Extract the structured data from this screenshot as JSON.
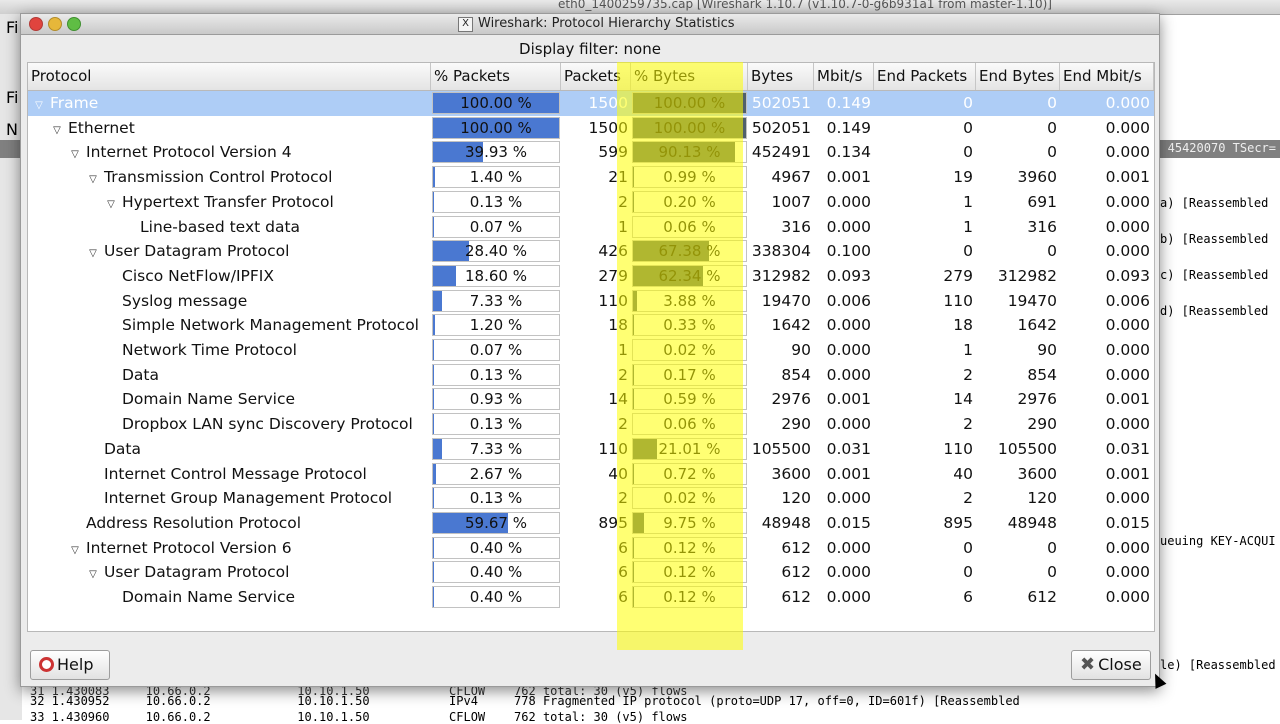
{
  "bg": {
    "title": "eth0_1400259735.cap   [Wireshark 1.10.7  (v1.10.7-0-g6b931a1 from master-1.10)]",
    "left_letters": [
      "Fi",
      "N",
      "Fi",
      "N"
    ],
    "strip_text": "45420070 TSecr=",
    "right_lines": [
      "a) [Reassembled",
      "b) [Reassembled",
      "c) [Reassembled",
      "d) [Reassembled",
      "ueuing KEY-ACQUI",
      "le) [Reassembled",
      "[Reassembled"
    ],
    "bottom_lines": [
      "31 1.430083     10.66.0.2            10.10.1.50           CFLOW    762 total: 30 (v5) flows",
      "32 1.430952     10.66.0.2            10.10.1.50           IPv4     778 Fragmented IP protocol (proto=UDP 17, off=0, ID=601f) [Reassembled",
      "33 1.430960     10.66.0.2            10.10.1.50           CFLOW    762 total: 30 (v5) flows"
    ]
  },
  "dialog": {
    "title": "Wireshark: Protocol Hierarchy Statistics",
    "filter": "Display filter: none",
    "help_label": "Help",
    "close_label": "Close"
  },
  "columns": [
    "Protocol",
    "% Packets",
    "Packets",
    "% Bytes",
    "Bytes",
    "Mbit/s",
    "End Packets",
    "End Bytes",
    "End Mbit/s"
  ],
  "rows": [
    {
      "name": "Frame",
      "indent": 0,
      "expand": true,
      "pct_packets": "100.00 %",
      "pct_packets_val": 100,
      "packets": "1500",
      "pct_bytes": "100.00 %",
      "pct_bytes_val": 100,
      "bytes": "502051",
      "mbit": "0.149",
      "end_packets": "0",
      "end_bytes": "0",
      "end_mbit": "0.000"
    },
    {
      "name": "Ethernet",
      "indent": 1,
      "expand": true,
      "pct_packets": "100.00 %",
      "pct_packets_val": 100,
      "packets": "1500",
      "pct_bytes": "100.00 %",
      "pct_bytes_val": 100,
      "bytes": "502051",
      "mbit": "0.149",
      "end_packets": "0",
      "end_bytes": "0",
      "end_mbit": "0.000"
    },
    {
      "name": "Internet Protocol Version 4",
      "indent": 2,
      "expand": true,
      "pct_packets": "39.93 %",
      "pct_packets_val": 39.93,
      "packets": "599",
      "pct_bytes": "90.13 %",
      "pct_bytes_val": 90.13,
      "bytes": "452491",
      "mbit": "0.134",
      "end_packets": "0",
      "end_bytes": "0",
      "end_mbit": "0.000"
    },
    {
      "name": "Transmission Control Protocol",
      "indent": 3,
      "expand": true,
      "pct_packets": "1.40 %",
      "pct_packets_val": 1.4,
      "packets": "21",
      "pct_bytes": "0.99 %",
      "pct_bytes_val": 0.99,
      "bytes": "4967",
      "mbit": "0.001",
      "end_packets": "19",
      "end_bytes": "3960",
      "end_mbit": "0.001"
    },
    {
      "name": "Hypertext Transfer Protocol",
      "indent": 4,
      "expand": true,
      "pct_packets": "0.13 %",
      "pct_packets_val": 0.13,
      "packets": "2",
      "pct_bytes": "0.20 %",
      "pct_bytes_val": 0.2,
      "bytes": "1007",
      "mbit": "0.000",
      "end_packets": "1",
      "end_bytes": "691",
      "end_mbit": "0.000"
    },
    {
      "name": "Line-based text data",
      "indent": 5,
      "expand": false,
      "pct_packets": "0.07 %",
      "pct_packets_val": 0.07,
      "packets": "1",
      "pct_bytes": "0.06 %",
      "pct_bytes_val": 0.06,
      "bytes": "316",
      "mbit": "0.000",
      "end_packets": "1",
      "end_bytes": "316",
      "end_mbit": "0.000"
    },
    {
      "name": "User Datagram Protocol",
      "indent": 3,
      "expand": true,
      "pct_packets": "28.40 %",
      "pct_packets_val": 28.4,
      "packets": "426",
      "pct_bytes": "67.38 %",
      "pct_bytes_val": 67.38,
      "bytes": "338304",
      "mbit": "0.100",
      "end_packets": "0",
      "end_bytes": "0",
      "end_mbit": "0.000"
    },
    {
      "name": "Cisco NetFlow/IPFIX",
      "indent": 4,
      "expand": false,
      "pct_packets": "18.60 %",
      "pct_packets_val": 18.6,
      "packets": "279",
      "pct_bytes": "62.34 %",
      "pct_bytes_val": 62.34,
      "bytes": "312982",
      "mbit": "0.093",
      "end_packets": "279",
      "end_bytes": "312982",
      "end_mbit": "0.093"
    },
    {
      "name": "Syslog message",
      "indent": 4,
      "expand": false,
      "pct_packets": "7.33 %",
      "pct_packets_val": 7.33,
      "packets": "110",
      "pct_bytes": "3.88 %",
      "pct_bytes_val": 3.88,
      "bytes": "19470",
      "mbit": "0.006",
      "end_packets": "110",
      "end_bytes": "19470",
      "end_mbit": "0.006"
    },
    {
      "name": "Simple Network Management Protocol",
      "indent": 4,
      "expand": false,
      "pct_packets": "1.20 %",
      "pct_packets_val": 1.2,
      "packets": "18",
      "pct_bytes": "0.33 %",
      "pct_bytes_val": 0.33,
      "bytes": "1642",
      "mbit": "0.000",
      "end_packets": "18",
      "end_bytes": "1642",
      "end_mbit": "0.000"
    },
    {
      "name": "Network Time Protocol",
      "indent": 4,
      "expand": false,
      "pct_packets": "0.07 %",
      "pct_packets_val": 0.07,
      "packets": "1",
      "pct_bytes": "0.02 %",
      "pct_bytes_val": 0.02,
      "bytes": "90",
      "mbit": "0.000",
      "end_packets": "1",
      "end_bytes": "90",
      "end_mbit": "0.000"
    },
    {
      "name": "Data",
      "indent": 4,
      "expand": false,
      "pct_packets": "0.13 %",
      "pct_packets_val": 0.13,
      "packets": "2",
      "pct_bytes": "0.17 %",
      "pct_bytes_val": 0.17,
      "bytes": "854",
      "mbit": "0.000",
      "end_packets": "2",
      "end_bytes": "854",
      "end_mbit": "0.000"
    },
    {
      "name": "Domain Name Service",
      "indent": 4,
      "expand": false,
      "pct_packets": "0.93 %",
      "pct_packets_val": 0.93,
      "packets": "14",
      "pct_bytes": "0.59 %",
      "pct_bytes_val": 0.59,
      "bytes": "2976",
      "mbit": "0.001",
      "end_packets": "14",
      "end_bytes": "2976",
      "end_mbit": "0.001"
    },
    {
      "name": "Dropbox LAN sync Discovery Protocol",
      "indent": 4,
      "expand": false,
      "pct_packets": "0.13 %",
      "pct_packets_val": 0.13,
      "packets": "2",
      "pct_bytes": "0.06 %",
      "pct_bytes_val": 0.06,
      "bytes": "290",
      "mbit": "0.000",
      "end_packets": "2",
      "end_bytes": "290",
      "end_mbit": "0.000"
    },
    {
      "name": "Data",
      "indent": 3,
      "expand": false,
      "pct_packets": "7.33 %",
      "pct_packets_val": 7.33,
      "packets": "110",
      "pct_bytes": "21.01 %",
      "pct_bytes_val": 21.01,
      "bytes": "105500",
      "mbit": "0.031",
      "end_packets": "110",
      "end_bytes": "105500",
      "end_mbit": "0.031"
    },
    {
      "name": "Internet Control Message Protocol",
      "indent": 3,
      "expand": false,
      "pct_packets": "2.67 %",
      "pct_packets_val": 2.67,
      "packets": "40",
      "pct_bytes": "0.72 %",
      "pct_bytes_val": 0.72,
      "bytes": "3600",
      "mbit": "0.001",
      "end_packets": "40",
      "end_bytes": "3600",
      "end_mbit": "0.001"
    },
    {
      "name": "Internet Group Management Protocol",
      "indent": 3,
      "expand": false,
      "pct_packets": "0.13 %",
      "pct_packets_val": 0.13,
      "packets": "2",
      "pct_bytes": "0.02 %",
      "pct_bytes_val": 0.02,
      "bytes": "120",
      "mbit": "0.000",
      "end_packets": "2",
      "end_bytes": "120",
      "end_mbit": "0.000"
    },
    {
      "name": "Address Resolution Protocol",
      "indent": 2,
      "expand": false,
      "pct_packets": "59.67 %",
      "pct_packets_val": 59.67,
      "packets": "895",
      "pct_bytes": "9.75 %",
      "pct_bytes_val": 9.75,
      "bytes": "48948",
      "mbit": "0.015",
      "end_packets": "895",
      "end_bytes": "48948",
      "end_mbit": "0.015"
    },
    {
      "name": "Internet Protocol Version 6",
      "indent": 2,
      "expand": true,
      "pct_packets": "0.40 %",
      "pct_packets_val": 0.4,
      "packets": "6",
      "pct_bytes": "0.12 %",
      "pct_bytes_val": 0.12,
      "bytes": "612",
      "mbit": "0.000",
      "end_packets": "0",
      "end_bytes": "0",
      "end_mbit": "0.000"
    },
    {
      "name": "User Datagram Protocol",
      "indent": 3,
      "expand": true,
      "pct_packets": "0.40 %",
      "pct_packets_val": 0.4,
      "packets": "6",
      "pct_bytes": "0.12 %",
      "pct_bytes_val": 0.12,
      "bytes": "612",
      "mbit": "0.000",
      "end_packets": "0",
      "end_bytes": "0",
      "end_mbit": "0.000"
    },
    {
      "name": "Domain Name Service",
      "indent": 4,
      "expand": false,
      "pct_packets": "0.40 %",
      "pct_packets_val": 0.4,
      "packets": "6",
      "pct_bytes": "0.12 %",
      "pct_bytes_val": 0.12,
      "bytes": "612",
      "mbit": "0.000",
      "end_packets": "6",
      "end_bytes": "612",
      "end_mbit": "0.000"
    }
  ],
  "selected_row": 0,
  "colors": {
    "packets_bar": "#4a78d1",
    "bytes_bar": "#50606b",
    "selection": "#aecdf6",
    "highlight": "#ffff00"
  }
}
